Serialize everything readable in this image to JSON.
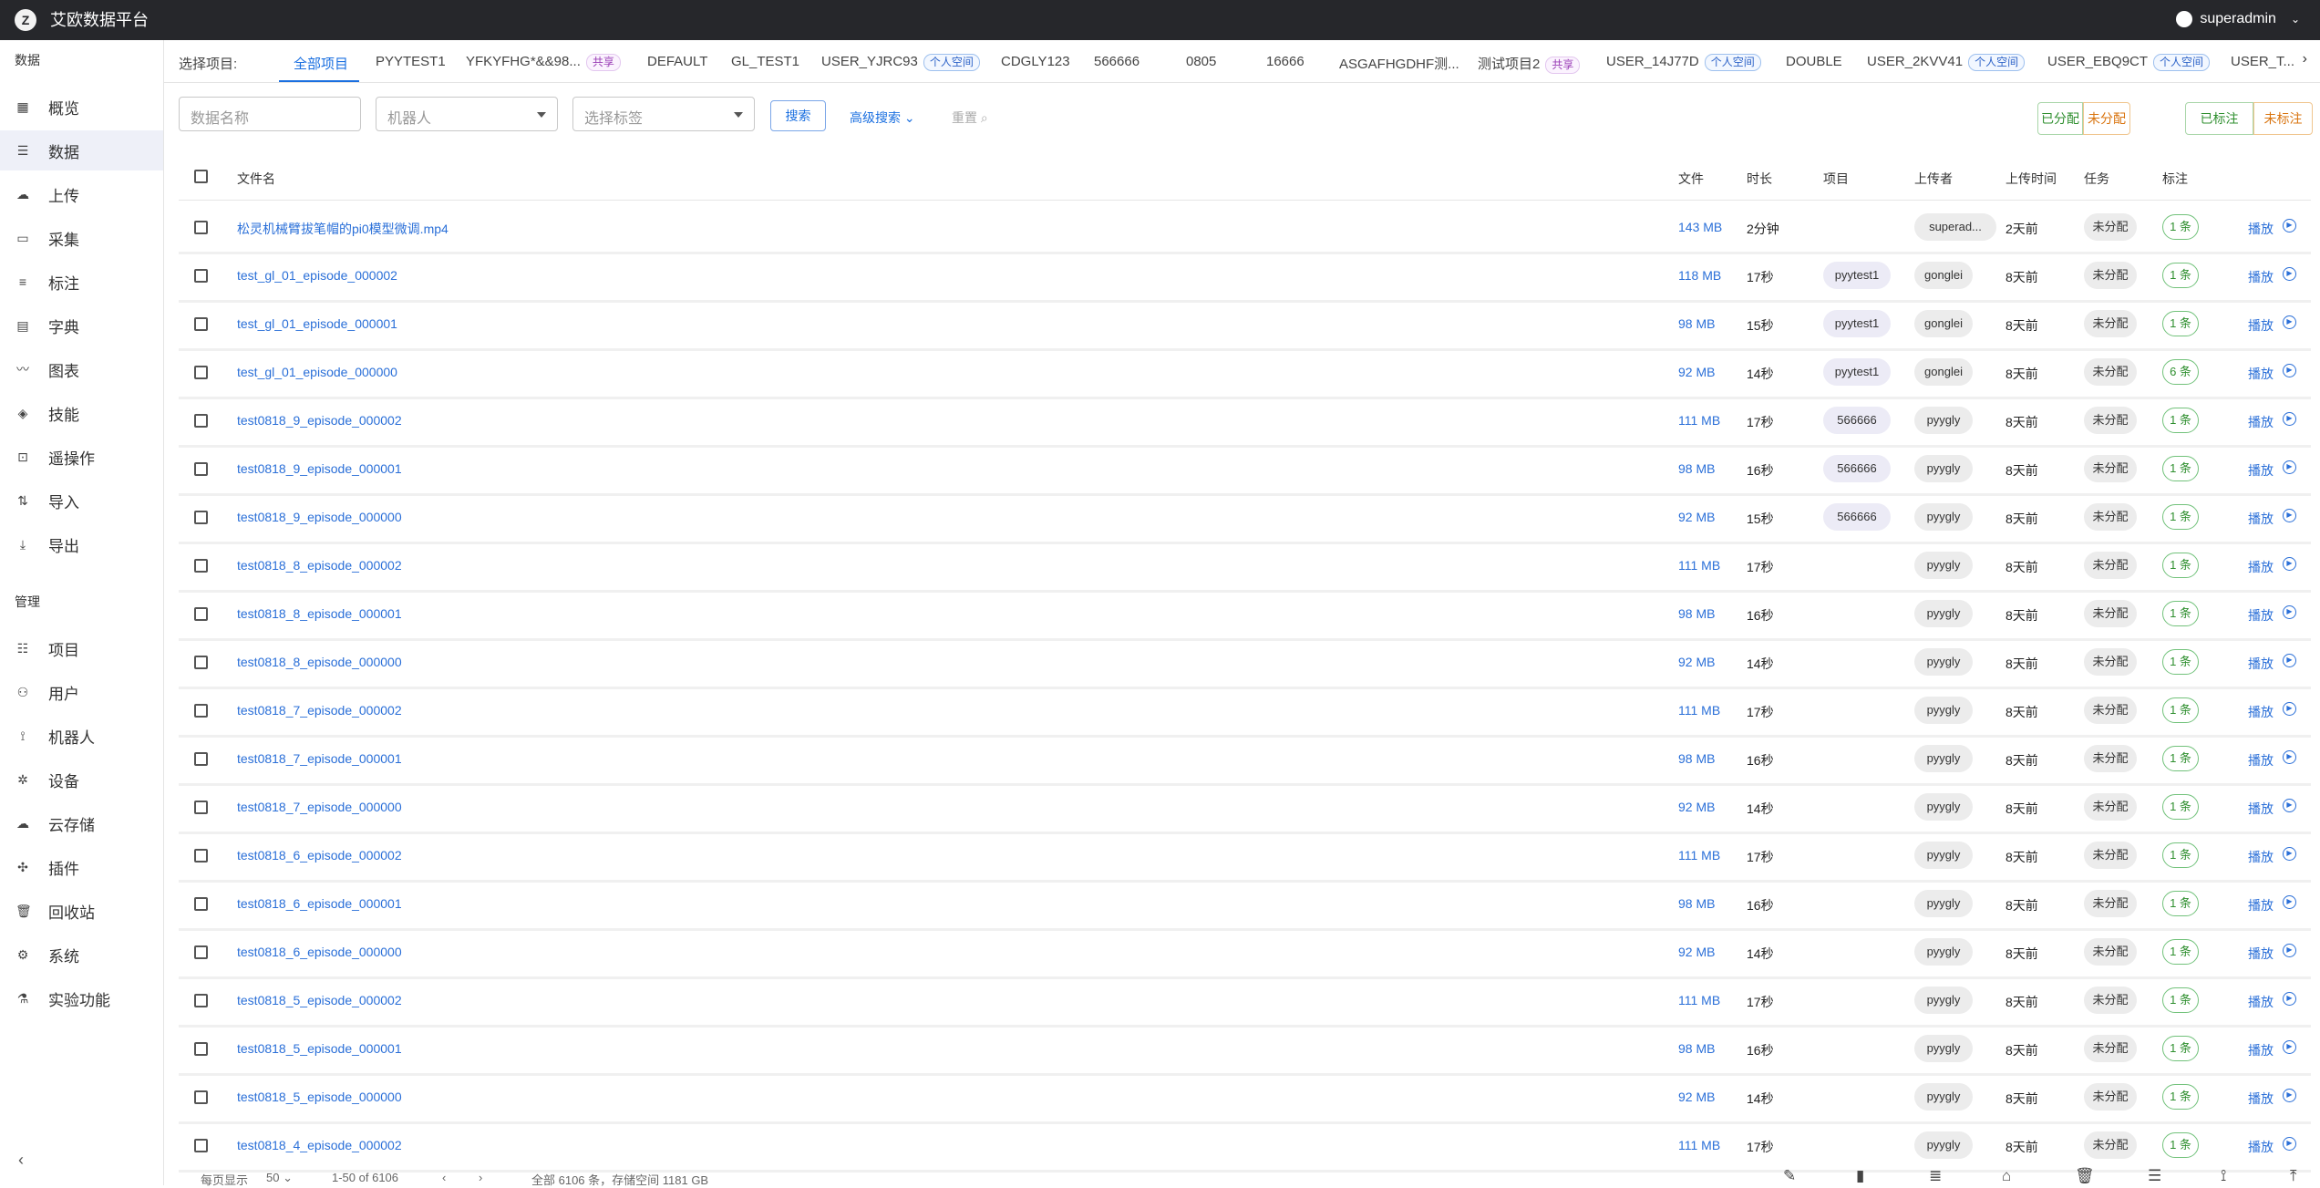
{
  "app": {
    "title": "艾欧数据平台",
    "logo_glyph": "Z",
    "user": "superadmin"
  },
  "sidebar": {
    "sections": [
      {
        "title": "数据",
        "items": [
          {
            "label": "概览",
            "icon": "dashboard-icon",
            "glyph": "▦"
          },
          {
            "label": "数据",
            "icon": "list-icon",
            "glyph": "☰",
            "active": true
          },
          {
            "label": "上传",
            "icon": "cloud-upload-icon",
            "glyph": "☁"
          },
          {
            "label": "采集",
            "icon": "video-camera-icon",
            "glyph": "▭"
          },
          {
            "label": "标注",
            "icon": "checklist-icon",
            "glyph": "≡"
          },
          {
            "label": "字典",
            "icon": "book-icon",
            "glyph": "▤"
          },
          {
            "label": "图表",
            "icon": "chart-line-icon",
            "glyph": "〰"
          },
          {
            "label": "技能",
            "icon": "pill-icon",
            "glyph": "◈"
          },
          {
            "label": "遥操作",
            "icon": "gamepad-icon",
            "glyph": "⊡"
          },
          {
            "label": "导入",
            "icon": "import-arrows-icon",
            "glyph": "⇅"
          },
          {
            "label": "导出",
            "icon": "download-icon",
            "glyph": "⤓"
          }
        ]
      },
      {
        "title": "管理",
        "items": [
          {
            "label": "项目",
            "icon": "project-icon",
            "glyph": "☷"
          },
          {
            "label": "用户",
            "icon": "users-icon",
            "glyph": "⚇"
          },
          {
            "label": "机器人",
            "icon": "robot-arm-icon",
            "glyph": "⟟"
          },
          {
            "label": "设备",
            "icon": "device-icon",
            "glyph": "✲"
          },
          {
            "label": "云存储",
            "icon": "cloud-icon",
            "glyph": "☁"
          },
          {
            "label": "插件",
            "icon": "puzzle-icon",
            "glyph": "✣"
          },
          {
            "label": "回收站",
            "icon": "trash-icon",
            "glyph": "🗑"
          },
          {
            "label": "系统",
            "icon": "gear-icon",
            "glyph": "⚙"
          },
          {
            "label": "实验功能",
            "icon": "flask-icon",
            "glyph": "⚗"
          }
        ]
      }
    ],
    "collapse_glyph": "‹"
  },
  "projects": {
    "label": "选择项目:",
    "tabs": [
      {
        "label": "全部项目",
        "active": true
      },
      {
        "label": "PYYTEST1"
      },
      {
        "label": "YFKYFHG*&&98...",
        "badge": "共享",
        "badge_type": "share"
      },
      {
        "label": "DEFAULT"
      },
      {
        "label": "GL_TEST1"
      },
      {
        "label": "USER_YJRC93",
        "badge": "个人空间",
        "badge_type": "personal"
      },
      {
        "label": "CDGLY123"
      },
      {
        "label": "566666"
      },
      {
        "label": "0805"
      },
      {
        "label": "16666"
      },
      {
        "label": "ASGAFHGDHF测..."
      },
      {
        "label": "测试项目2",
        "badge": "共享",
        "badge_type": "share"
      },
      {
        "label": "USER_14J77D",
        "badge": "个人空间",
        "badge_type": "personal"
      },
      {
        "label": "DOUBLE"
      },
      {
        "label": "USER_2KVV41",
        "badge": "个人空间",
        "badge_type": "personal"
      },
      {
        "label": "USER_EBQ9CT",
        "badge": "个人空间",
        "badge_type": "personal"
      },
      {
        "label": "USER_T..."
      }
    ]
  },
  "filters": {
    "name_placeholder": "数据名称",
    "robot_placeholder": "机器人",
    "tag_placeholder": "选择标签",
    "search": "搜索",
    "advanced": "高级搜索",
    "reset": "重置",
    "assigned": "已分配",
    "unassigned": "未分配",
    "annotated": "已标注",
    "unannotated": "未标注"
  },
  "table": {
    "headers": {
      "filename": "文件名",
      "file": "文件",
      "duration": "时长",
      "project": "项目",
      "uploader": "上传者",
      "upload_time": "上传时间",
      "task": "任务",
      "annotation": "标注"
    },
    "play_label": "播放",
    "rows": [
      {
        "name": "松灵机械臂拔笔帽的pi0模型微调.mp4",
        "size": "143 MB",
        "duration": "2分钟",
        "project": "",
        "uploader": "superad...",
        "time": "2天前",
        "task": "未分配",
        "anno": "1 条"
      },
      {
        "name": "test_gl_01_episode_000002",
        "size": "118 MB",
        "duration": "17秒",
        "project": "pyytest1",
        "uploader": "gonglei",
        "time": "8天前",
        "task": "未分配",
        "anno": "1 条"
      },
      {
        "name": "test_gl_01_episode_000001",
        "size": "98 MB",
        "duration": "15秒",
        "project": "pyytest1",
        "uploader": "gonglei",
        "time": "8天前",
        "task": "未分配",
        "anno": "1 条"
      },
      {
        "name": "test_gl_01_episode_000000",
        "size": "92 MB",
        "duration": "14秒",
        "project": "pyytest1",
        "uploader": "gonglei",
        "time": "8天前",
        "task": "未分配",
        "anno": "6 条"
      },
      {
        "name": "test0818_9_episode_000002",
        "size": "111 MB",
        "duration": "17秒",
        "project": "566666",
        "uploader": "pyygly",
        "time": "8天前",
        "task": "未分配",
        "anno": "1 条"
      },
      {
        "name": "test0818_9_episode_000001",
        "size": "98 MB",
        "duration": "16秒",
        "project": "566666",
        "uploader": "pyygly",
        "time": "8天前",
        "task": "未分配",
        "anno": "1 条"
      },
      {
        "name": "test0818_9_episode_000000",
        "size": "92 MB",
        "duration": "15秒",
        "project": "566666",
        "uploader": "pyygly",
        "time": "8天前",
        "task": "未分配",
        "anno": "1 条"
      },
      {
        "name": "test0818_8_episode_000002",
        "size": "111 MB",
        "duration": "17秒",
        "project": "",
        "uploader": "pyygly",
        "time": "8天前",
        "task": "未分配",
        "anno": "1 条"
      },
      {
        "name": "test0818_8_episode_000001",
        "size": "98 MB",
        "duration": "16秒",
        "project": "",
        "uploader": "pyygly",
        "time": "8天前",
        "task": "未分配",
        "anno": "1 条"
      },
      {
        "name": "test0818_8_episode_000000",
        "size": "92 MB",
        "duration": "14秒",
        "project": "",
        "uploader": "pyygly",
        "time": "8天前",
        "task": "未分配",
        "anno": "1 条"
      },
      {
        "name": "test0818_7_episode_000002",
        "size": "111 MB",
        "duration": "17秒",
        "project": "",
        "uploader": "pyygly",
        "time": "8天前",
        "task": "未分配",
        "anno": "1 条"
      },
      {
        "name": "test0818_7_episode_000001",
        "size": "98 MB",
        "duration": "16秒",
        "project": "",
        "uploader": "pyygly",
        "time": "8天前",
        "task": "未分配",
        "anno": "1 条"
      },
      {
        "name": "test0818_7_episode_000000",
        "size": "92 MB",
        "duration": "14秒",
        "project": "",
        "uploader": "pyygly",
        "time": "8天前",
        "task": "未分配",
        "anno": "1 条"
      },
      {
        "name": "test0818_6_episode_000002",
        "size": "111 MB",
        "duration": "17秒",
        "project": "",
        "uploader": "pyygly",
        "time": "8天前",
        "task": "未分配",
        "anno": "1 条"
      },
      {
        "name": "test0818_6_episode_000001",
        "size": "98 MB",
        "duration": "16秒",
        "project": "",
        "uploader": "pyygly",
        "time": "8天前",
        "task": "未分配",
        "anno": "1 条"
      },
      {
        "name": "test0818_6_episode_000000",
        "size": "92 MB",
        "duration": "14秒",
        "project": "",
        "uploader": "pyygly",
        "time": "8天前",
        "task": "未分配",
        "anno": "1 条"
      },
      {
        "name": "test0818_5_episode_000002",
        "size": "111 MB",
        "duration": "17秒",
        "project": "",
        "uploader": "pyygly",
        "time": "8天前",
        "task": "未分配",
        "anno": "1 条"
      },
      {
        "name": "test0818_5_episode_000001",
        "size": "98 MB",
        "duration": "16秒",
        "project": "",
        "uploader": "pyygly",
        "time": "8天前",
        "task": "未分配",
        "anno": "1 条"
      },
      {
        "name": "test0818_5_episode_000000",
        "size": "92 MB",
        "duration": "14秒",
        "project": "",
        "uploader": "pyygly",
        "time": "8天前",
        "task": "未分配",
        "anno": "1 条"
      },
      {
        "name": "test0818_4_episode_000002",
        "size": "111 MB",
        "duration": "17秒",
        "project": "",
        "uploader": "pyygly",
        "time": "8天前",
        "task": "未分配",
        "anno": "1 条"
      }
    ]
  },
  "footer": {
    "per_page_label": "每页显示",
    "per_page": "50",
    "range": "1-50 of 6106",
    "summary": "全部 6106 条，存储空间 1181 GB",
    "tools": [
      {
        "icon": "edit-icon",
        "glyph": "✎"
      },
      {
        "icon": "bar-chart-icon",
        "glyph": "▮"
      },
      {
        "icon": "numbered-list-icon",
        "glyph": "≣"
      },
      {
        "icon": "tag-icon",
        "glyph": "⌂"
      },
      {
        "icon": "delete-icon",
        "glyph": "🗑"
      },
      {
        "icon": "list-detail-icon",
        "glyph": "☰"
      },
      {
        "icon": "robot-arm-icon",
        "glyph": "⟟"
      },
      {
        "icon": "scroll-top-icon",
        "glyph": "⤒"
      }
    ]
  }
}
